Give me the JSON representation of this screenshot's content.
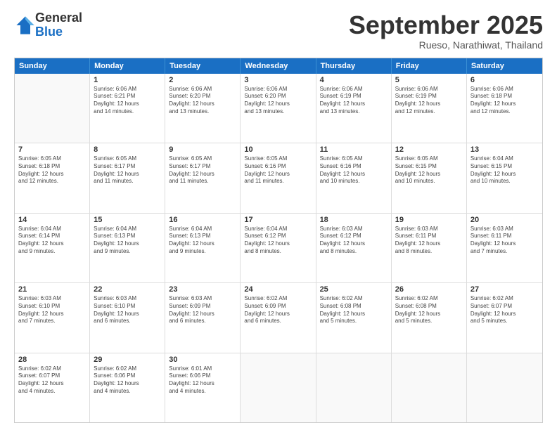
{
  "logo": {
    "general": "General",
    "blue": "Blue"
  },
  "title": "September 2025",
  "subtitle": "Rueso, Narathiwat, Thailand",
  "header_days": [
    "Sunday",
    "Monday",
    "Tuesday",
    "Wednesday",
    "Thursday",
    "Friday",
    "Saturday"
  ],
  "weeks": [
    [
      {
        "day": "",
        "lines": []
      },
      {
        "day": "1",
        "lines": [
          "Sunrise: 6:06 AM",
          "Sunset: 6:21 PM",
          "Daylight: 12 hours",
          "and 14 minutes."
        ]
      },
      {
        "day": "2",
        "lines": [
          "Sunrise: 6:06 AM",
          "Sunset: 6:20 PM",
          "Daylight: 12 hours",
          "and 13 minutes."
        ]
      },
      {
        "day": "3",
        "lines": [
          "Sunrise: 6:06 AM",
          "Sunset: 6:20 PM",
          "Daylight: 12 hours",
          "and 13 minutes."
        ]
      },
      {
        "day": "4",
        "lines": [
          "Sunrise: 6:06 AM",
          "Sunset: 6:19 PM",
          "Daylight: 12 hours",
          "and 13 minutes."
        ]
      },
      {
        "day": "5",
        "lines": [
          "Sunrise: 6:06 AM",
          "Sunset: 6:19 PM",
          "Daylight: 12 hours",
          "and 12 minutes."
        ]
      },
      {
        "day": "6",
        "lines": [
          "Sunrise: 6:06 AM",
          "Sunset: 6:18 PM",
          "Daylight: 12 hours",
          "and 12 minutes."
        ]
      }
    ],
    [
      {
        "day": "7",
        "lines": [
          "Sunrise: 6:05 AM",
          "Sunset: 6:18 PM",
          "Daylight: 12 hours",
          "and 12 minutes."
        ]
      },
      {
        "day": "8",
        "lines": [
          "Sunrise: 6:05 AM",
          "Sunset: 6:17 PM",
          "Daylight: 12 hours",
          "and 11 minutes."
        ]
      },
      {
        "day": "9",
        "lines": [
          "Sunrise: 6:05 AM",
          "Sunset: 6:17 PM",
          "Daylight: 12 hours",
          "and 11 minutes."
        ]
      },
      {
        "day": "10",
        "lines": [
          "Sunrise: 6:05 AM",
          "Sunset: 6:16 PM",
          "Daylight: 12 hours",
          "and 11 minutes."
        ]
      },
      {
        "day": "11",
        "lines": [
          "Sunrise: 6:05 AM",
          "Sunset: 6:16 PM",
          "Daylight: 12 hours",
          "and 10 minutes."
        ]
      },
      {
        "day": "12",
        "lines": [
          "Sunrise: 6:05 AM",
          "Sunset: 6:15 PM",
          "Daylight: 12 hours",
          "and 10 minutes."
        ]
      },
      {
        "day": "13",
        "lines": [
          "Sunrise: 6:04 AM",
          "Sunset: 6:15 PM",
          "Daylight: 12 hours",
          "and 10 minutes."
        ]
      }
    ],
    [
      {
        "day": "14",
        "lines": [
          "Sunrise: 6:04 AM",
          "Sunset: 6:14 PM",
          "Daylight: 12 hours",
          "and 9 minutes."
        ]
      },
      {
        "day": "15",
        "lines": [
          "Sunrise: 6:04 AM",
          "Sunset: 6:13 PM",
          "Daylight: 12 hours",
          "and 9 minutes."
        ]
      },
      {
        "day": "16",
        "lines": [
          "Sunrise: 6:04 AM",
          "Sunset: 6:13 PM",
          "Daylight: 12 hours",
          "and 9 minutes."
        ]
      },
      {
        "day": "17",
        "lines": [
          "Sunrise: 6:04 AM",
          "Sunset: 6:12 PM",
          "Daylight: 12 hours",
          "and 8 minutes."
        ]
      },
      {
        "day": "18",
        "lines": [
          "Sunrise: 6:03 AM",
          "Sunset: 6:12 PM",
          "Daylight: 12 hours",
          "and 8 minutes."
        ]
      },
      {
        "day": "19",
        "lines": [
          "Sunrise: 6:03 AM",
          "Sunset: 6:11 PM",
          "Daylight: 12 hours",
          "and 8 minutes."
        ]
      },
      {
        "day": "20",
        "lines": [
          "Sunrise: 6:03 AM",
          "Sunset: 6:11 PM",
          "Daylight: 12 hours",
          "and 7 minutes."
        ]
      }
    ],
    [
      {
        "day": "21",
        "lines": [
          "Sunrise: 6:03 AM",
          "Sunset: 6:10 PM",
          "Daylight: 12 hours",
          "and 7 minutes."
        ]
      },
      {
        "day": "22",
        "lines": [
          "Sunrise: 6:03 AM",
          "Sunset: 6:10 PM",
          "Daylight: 12 hours",
          "and 6 minutes."
        ]
      },
      {
        "day": "23",
        "lines": [
          "Sunrise: 6:03 AM",
          "Sunset: 6:09 PM",
          "Daylight: 12 hours",
          "and 6 minutes."
        ]
      },
      {
        "day": "24",
        "lines": [
          "Sunrise: 6:02 AM",
          "Sunset: 6:09 PM",
          "Daylight: 12 hours",
          "and 6 minutes."
        ]
      },
      {
        "day": "25",
        "lines": [
          "Sunrise: 6:02 AM",
          "Sunset: 6:08 PM",
          "Daylight: 12 hours",
          "and 5 minutes."
        ]
      },
      {
        "day": "26",
        "lines": [
          "Sunrise: 6:02 AM",
          "Sunset: 6:08 PM",
          "Daylight: 12 hours",
          "and 5 minutes."
        ]
      },
      {
        "day": "27",
        "lines": [
          "Sunrise: 6:02 AM",
          "Sunset: 6:07 PM",
          "Daylight: 12 hours",
          "and 5 minutes."
        ]
      }
    ],
    [
      {
        "day": "28",
        "lines": [
          "Sunrise: 6:02 AM",
          "Sunset: 6:07 PM",
          "Daylight: 12 hours",
          "and 4 minutes."
        ]
      },
      {
        "day": "29",
        "lines": [
          "Sunrise: 6:02 AM",
          "Sunset: 6:06 PM",
          "Daylight: 12 hours",
          "and 4 minutes."
        ]
      },
      {
        "day": "30",
        "lines": [
          "Sunrise: 6:01 AM",
          "Sunset: 6:06 PM",
          "Daylight: 12 hours",
          "and 4 minutes."
        ]
      },
      {
        "day": "",
        "lines": []
      },
      {
        "day": "",
        "lines": []
      },
      {
        "day": "",
        "lines": []
      },
      {
        "day": "",
        "lines": []
      }
    ]
  ]
}
